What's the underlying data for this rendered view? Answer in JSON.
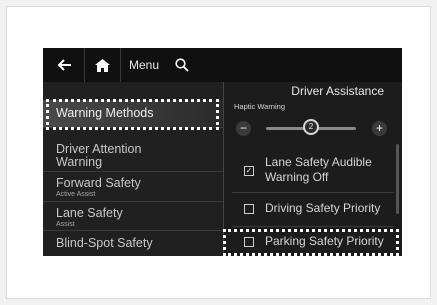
{
  "topbar": {
    "back_icon": "back-arrow-icon",
    "home_icon": "home-icon",
    "menu_label": "Menu",
    "search_icon": "search-icon"
  },
  "left_menu": {
    "items": [
      {
        "label": "Warning Methods",
        "sub": "",
        "active": true
      },
      {
        "label": "Driver Attention Warning",
        "sub": "",
        "active": false
      },
      {
        "label": "Forward Safety",
        "sub": "Active Assist",
        "active": false
      },
      {
        "label": "Lane Safety",
        "sub": "Assist",
        "active": false
      },
      {
        "label": "Blind-Spot Safety",
        "sub": "",
        "active": false
      }
    ]
  },
  "right_panel": {
    "title": "Driver Assistance",
    "haptic": {
      "label": "Haptic Warning",
      "minus": "−",
      "plus": "+",
      "value": "2",
      "min": 0,
      "max": 4
    },
    "options": [
      {
        "label": "Lane Safety Audible Warning Off",
        "checked": true
      },
      {
        "label": "Driving Safety Priority",
        "checked": false
      },
      {
        "label": "Parking Safety Priority",
        "checked": false
      }
    ]
  },
  "colors": {
    "screen_bg": "#1c1c1c",
    "highlight": "#ffffff"
  }
}
